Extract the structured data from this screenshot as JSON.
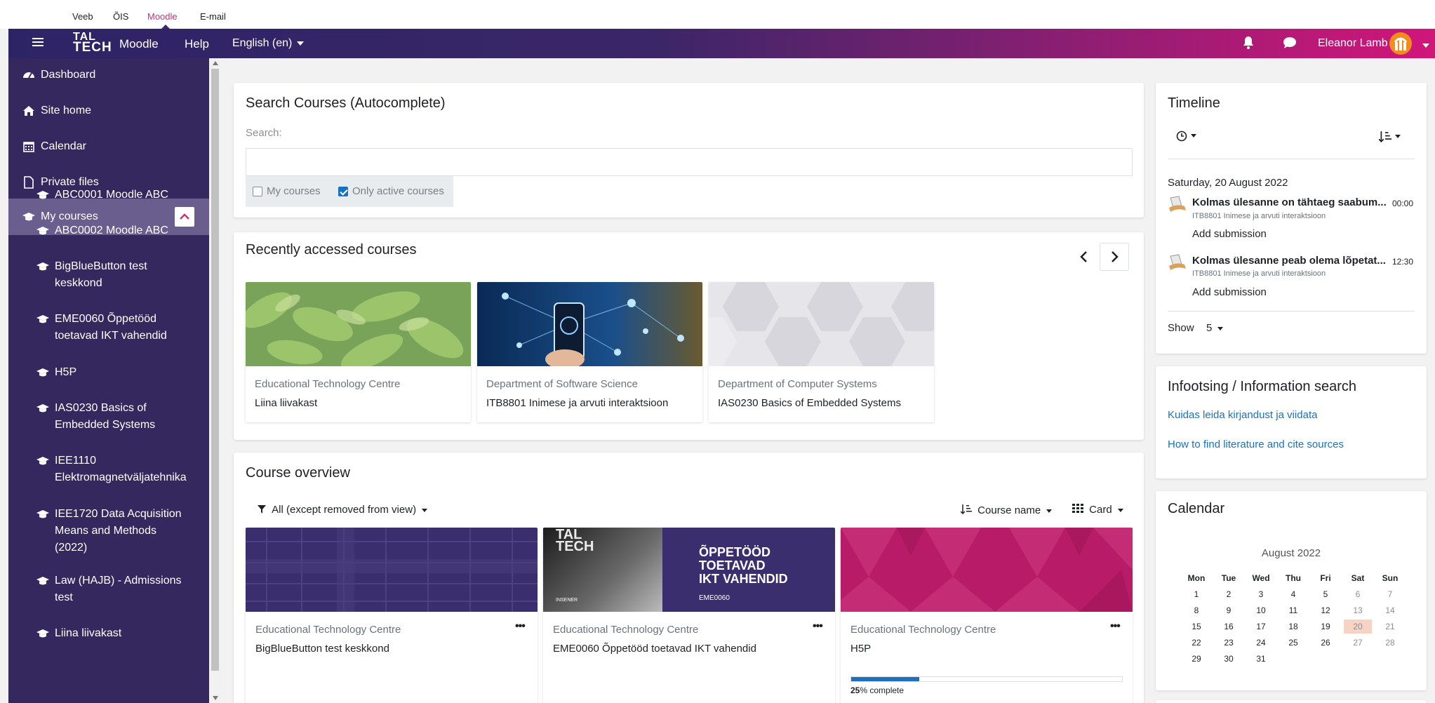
{
  "top_links": [
    "Veeb",
    "ÕIS",
    "Moodle",
    "E-mail"
  ],
  "navbar": {
    "logo_line1": "TAL",
    "logo_line2": "TECH",
    "brand": "Moodle",
    "help": "Help",
    "language": "English (en)",
    "user_name": "Eleanor Lamb"
  },
  "sidebar": {
    "items": [
      {
        "label": "Dashboard",
        "icon": "dashboard-icon"
      },
      {
        "label": "Site home",
        "icon": "home-icon"
      },
      {
        "label": "Calendar",
        "icon": "calendar-icon"
      },
      {
        "label": "Private files",
        "icon": "file-icon"
      },
      {
        "label": "My courses",
        "icon": "graduation-cap-icon"
      }
    ],
    "courses": [
      {
        "line1": "ABC0001 Moodle ABC",
        "line2": "",
        "line3": ""
      },
      {
        "line1": "ABC0002 Moodle ABC",
        "line2": "",
        "line3": ""
      },
      {
        "line1": "BigBlueButton test",
        "line2": "keskkond",
        "line3": ""
      },
      {
        "line1": "EME0060 Õppetööd",
        "line2": "toetavad IKT vahendid",
        "line3": ""
      },
      {
        "line1": "H5P",
        "line2": "",
        "line3": ""
      },
      {
        "line1": "IAS0230 Basics of",
        "line2": "Embedded Systems",
        "line3": ""
      },
      {
        "line1": "IEE1110",
        "line2": "Elektromagnetväljatehnika",
        "line3": ""
      },
      {
        "line1": "IEE1720 Data Acquisition",
        "line2": "Means and Methods",
        "line3": "(2022)"
      },
      {
        "line1": "Law (HAJB) - Admissions",
        "line2": "test",
        "line3": ""
      },
      {
        "line1": "Liina liivakast",
        "line2": "",
        "line3": ""
      }
    ]
  },
  "search_card": {
    "title": "Search Courses (Autocomplete)",
    "label": "Search:",
    "value": "",
    "my_courses": "My courses",
    "only_active": "Only active courses",
    "my_courses_checked": false,
    "only_active_checked": true
  },
  "recent": {
    "title": "Recently accessed courses",
    "courses": [
      {
        "category": "Educational Technology Centre",
        "name": "Liina liivakast"
      },
      {
        "category": "Department of Software Science",
        "name": "ITB8801 Inimese ja arvuti interaktsioon"
      },
      {
        "category": "Department of Computer Systems",
        "name": "IAS0230 Basics of Embedded Systems"
      }
    ]
  },
  "overview": {
    "title": "Course overview",
    "filter": "All (except removed from view)",
    "sort": "Course name",
    "view": "Card",
    "courses": [
      {
        "category": "Educational Technology Centre",
        "name": "BigBlueButton test keskkond"
      },
      {
        "category": "Educational Technology Centre",
        "name": "EME0060 Õppetööd toetavad IKT vahendid",
        "banner": [
          "ÕPPETÖÖD",
          "TOETAVAD",
          "IKT VAHENDID"
        ],
        "banner_code": "EME0060",
        "banner_logo": [
          "TAL",
          "TECH"
        ],
        "banner_small": "INSENER"
      },
      {
        "category": "Educational Technology Centre",
        "name": "H5P",
        "progress": 25,
        "progress_pct": "25",
        "progress_label": "% complete"
      }
    ]
  },
  "timeline": {
    "title": "Timeline",
    "date": "Saturday, 20 August 2022",
    "events": [
      {
        "title": "Kolmas ülesanne on tähtaeg saabum...",
        "course": "ITB8801 Inimese ja arvuti interaktsioon",
        "time": "00:00",
        "action": "Add submission"
      },
      {
        "title": "Kolmas ülesanne peab olema lõpetat...",
        "course": "ITB8801 Inimese ja arvuti interaktsioon",
        "time": "12:30",
        "action": "Add submission"
      }
    ],
    "show_label": "Show",
    "show_value": "5"
  },
  "info": {
    "title": "Infootsing / Information search",
    "links": [
      "Kuidas leida kirjandust ja viidata",
      "How to find literature and cite sources"
    ]
  },
  "calendar": {
    "title": "Calendar",
    "month": "August 2022",
    "headers": [
      "Mon",
      "Tue",
      "Wed",
      "Thu",
      "Fri",
      "Sat",
      "Sun"
    ],
    "weeks": [
      [
        "1",
        "2",
        "3",
        "4",
        "5",
        "6",
        "7"
      ],
      [
        "8",
        "9",
        "10",
        "11",
        "12",
        "13",
        "14"
      ],
      [
        "15",
        "16",
        "17",
        "18",
        "19",
        "20",
        "21"
      ],
      [
        "22",
        "23",
        "24",
        "25",
        "26",
        "27",
        "28"
      ],
      [
        "29",
        "30",
        "31",
        "",
        "",
        "",
        ""
      ]
    ],
    "today": "20"
  },
  "colors": {
    "accent": "#1872c4",
    "sidebar": "#35285e",
    "sidebar_active": "#6a5e8f",
    "highlight_link": "#c8327a",
    "today_bg": "#f7d3c4"
  }
}
